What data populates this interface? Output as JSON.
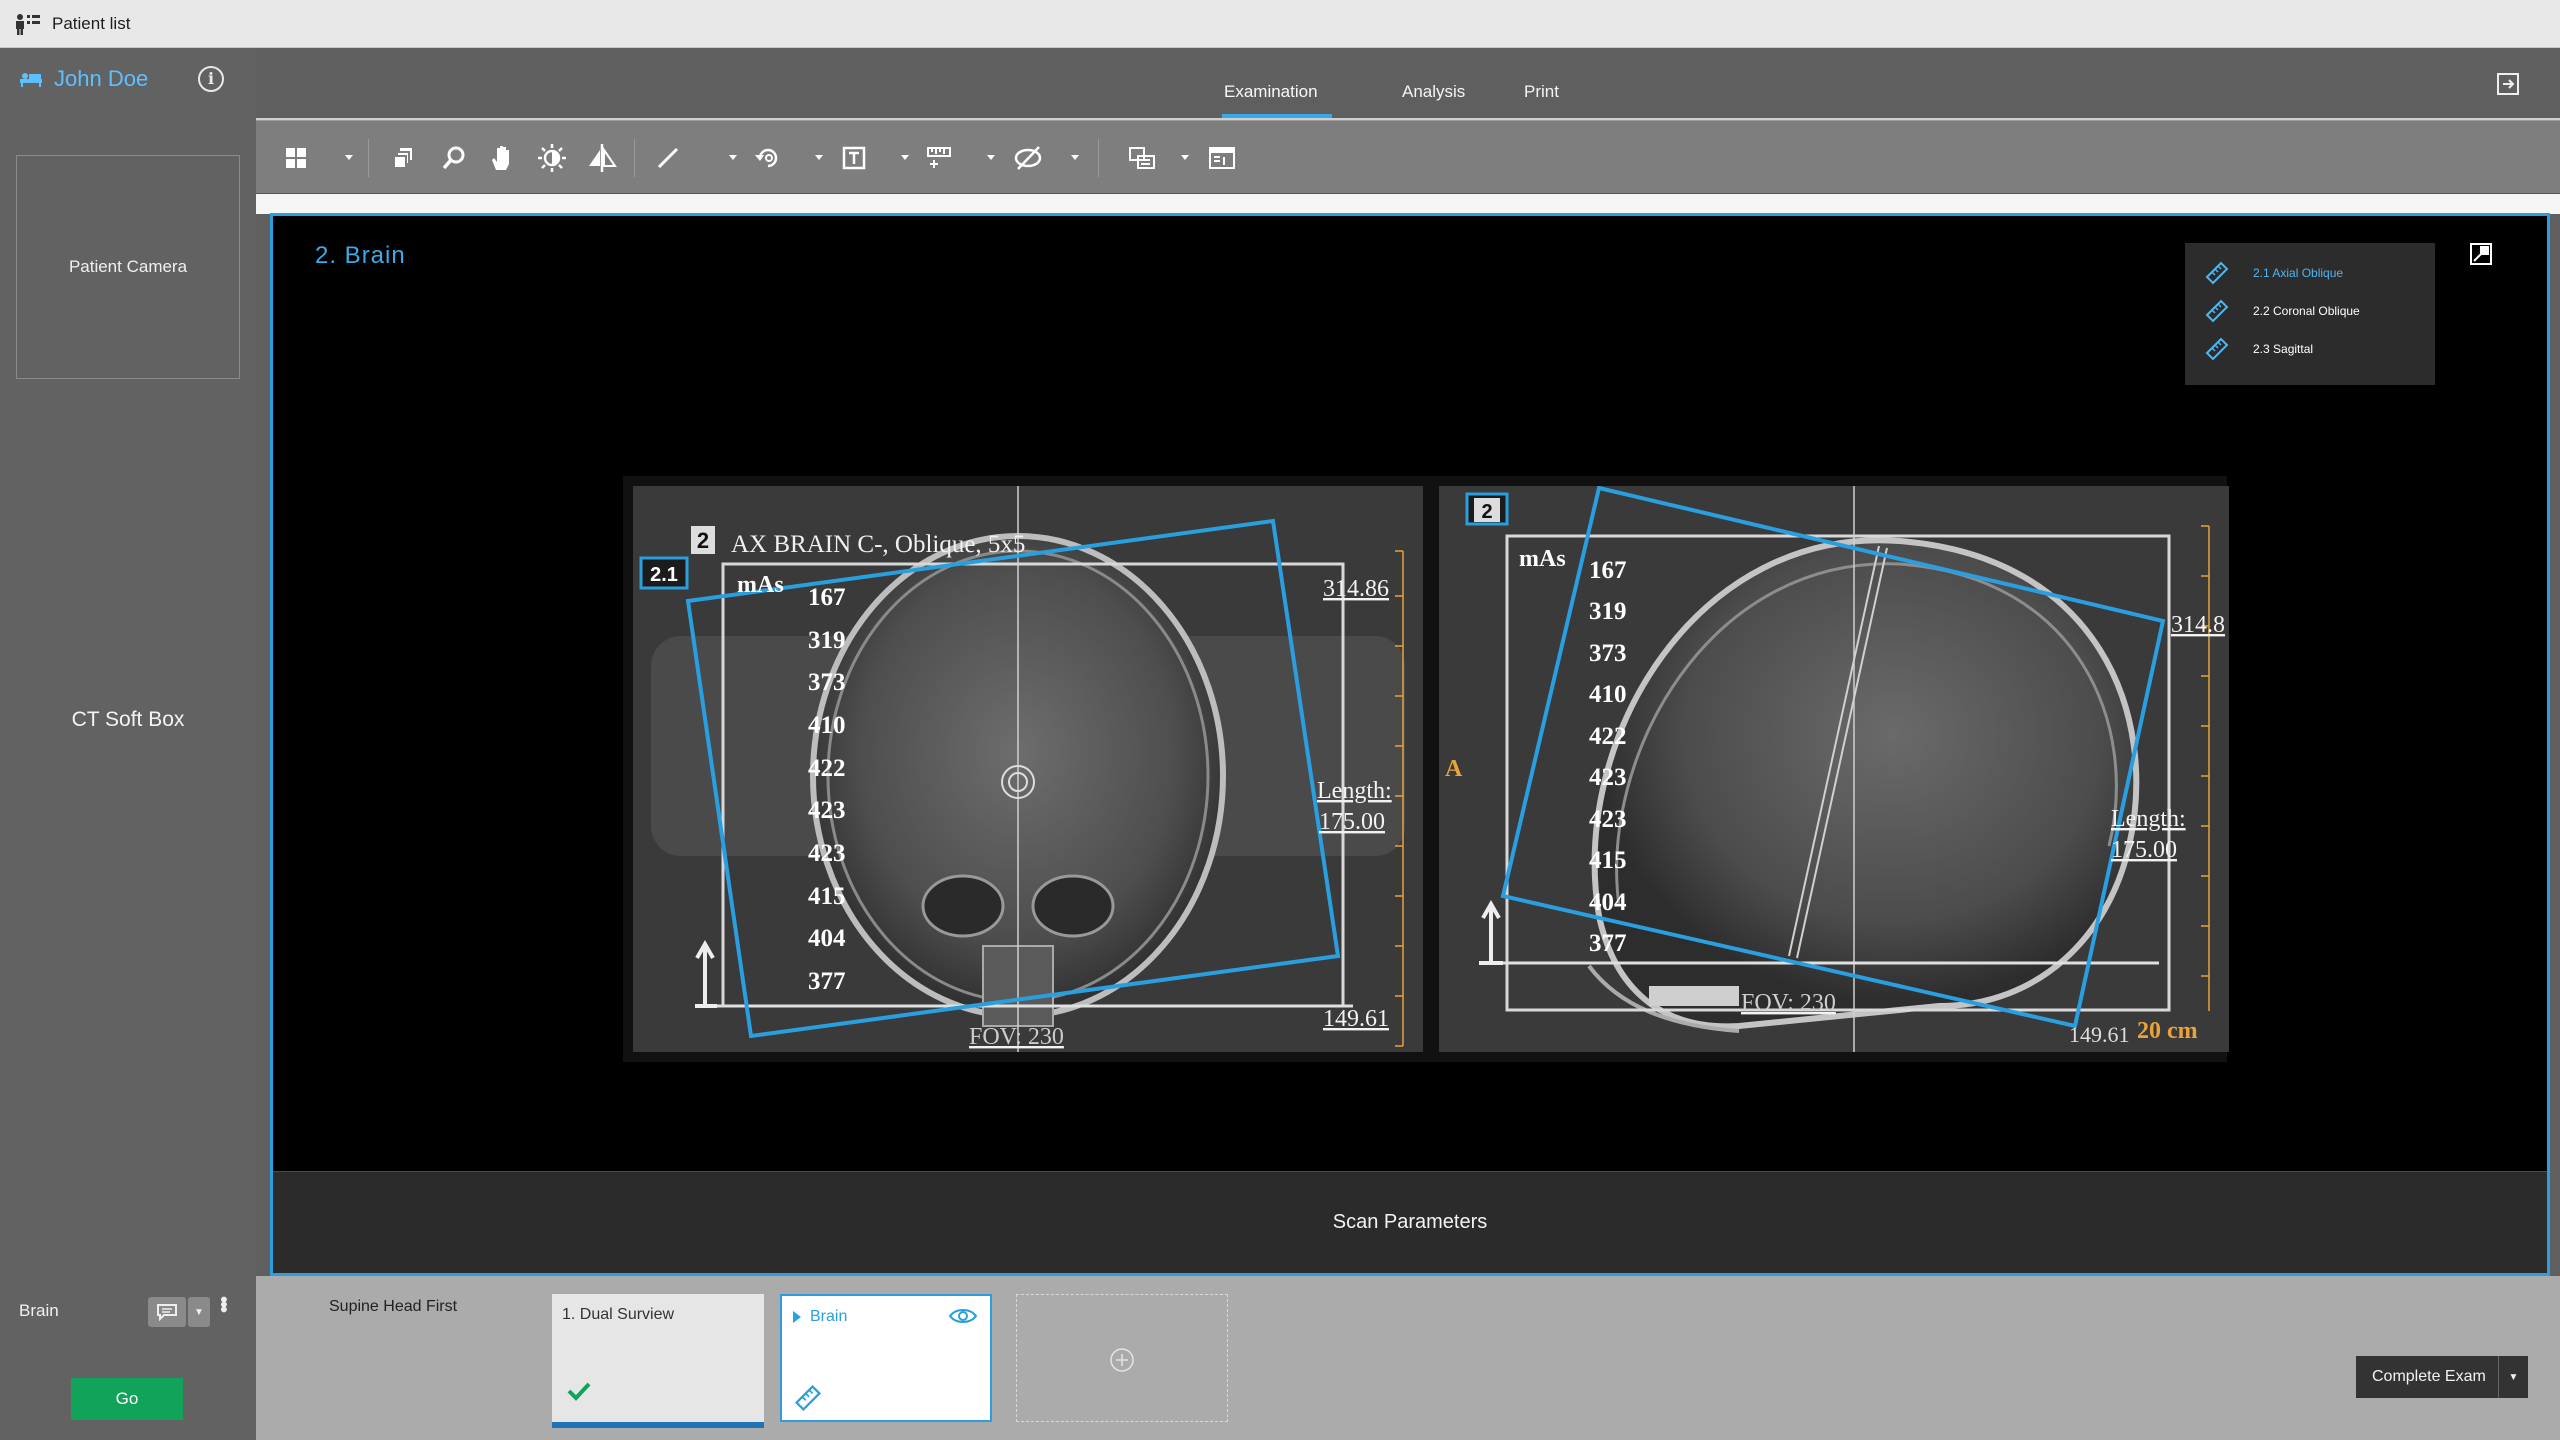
{
  "topbar": {
    "patient_list": "Patient list"
  },
  "sidebar": {
    "patient_name": "John Doe",
    "info": "i",
    "patient_camera": "Patient Camera",
    "ct_soft_box": "CT Soft Box",
    "protocol_label": "Brain",
    "go_label": "Go"
  },
  "tabs": [
    {
      "label": "Examination",
      "active": true
    },
    {
      "label": "Analysis",
      "active": false
    },
    {
      "label": "Print",
      "active": false
    }
  ],
  "toolbar": {
    "tools": [
      "layout-grid-icon",
      "stack-icon",
      "zoom-icon",
      "pan-hand-icon",
      "brightness-icon",
      "flip-icon",
      "measure-line-icon",
      "rotate-icon",
      "text-annotation-icon",
      "ruler-icon",
      "hide-overlay-icon",
      "compare-icon",
      "info-overlay-icon"
    ]
  },
  "viewport": {
    "title": "2. Brain",
    "series": [
      {
        "label": "2.1 Axial Oblique",
        "active": true
      },
      {
        "label": "2.2 Coronal Oblique",
        "active": false
      },
      {
        "label": "2.3 Sagittal",
        "active": false
      }
    ],
    "left_image": {
      "series_tag": "2.1",
      "number_tag": "2",
      "header": "AX BRAIN C-, Oblique, 5x5",
      "mas_label": "mAs",
      "mas_values": [
        "167",
        "319",
        "373",
        "410",
        "422",
        "423",
        "423",
        "415",
        "404",
        "377"
      ],
      "top_value": "314.86",
      "length_label": "Length:",
      "length_value": "175.00",
      "bottom_value": "149.61",
      "fov": "FOV: 230"
    },
    "right_image": {
      "number_tag": "2",
      "mas_label": "mAs",
      "mas_values": [
        "167",
        "319",
        "373",
        "410",
        "422",
        "423",
        "423",
        "415",
        "404",
        "377"
      ],
      "top_value": "314.8",
      "length_label": "Length:",
      "length_value": "175.00",
      "bottom_value": "149.61",
      "fov": "FOV: 230",
      "scale": "20 cm",
      "orientation": "A"
    },
    "scan_parameters": "Scan Parameters"
  },
  "bottom": {
    "position": "Supine Head First",
    "cards": [
      {
        "title": "1. Dual Surview",
        "status": "done"
      },
      {
        "title": "Brain",
        "status": "active"
      }
    ],
    "complete_exam": "Complete Exam"
  },
  "colors": {
    "accent": "#2a9fe0",
    "go": "#11a35a",
    "annotation": "#e8a33a"
  }
}
